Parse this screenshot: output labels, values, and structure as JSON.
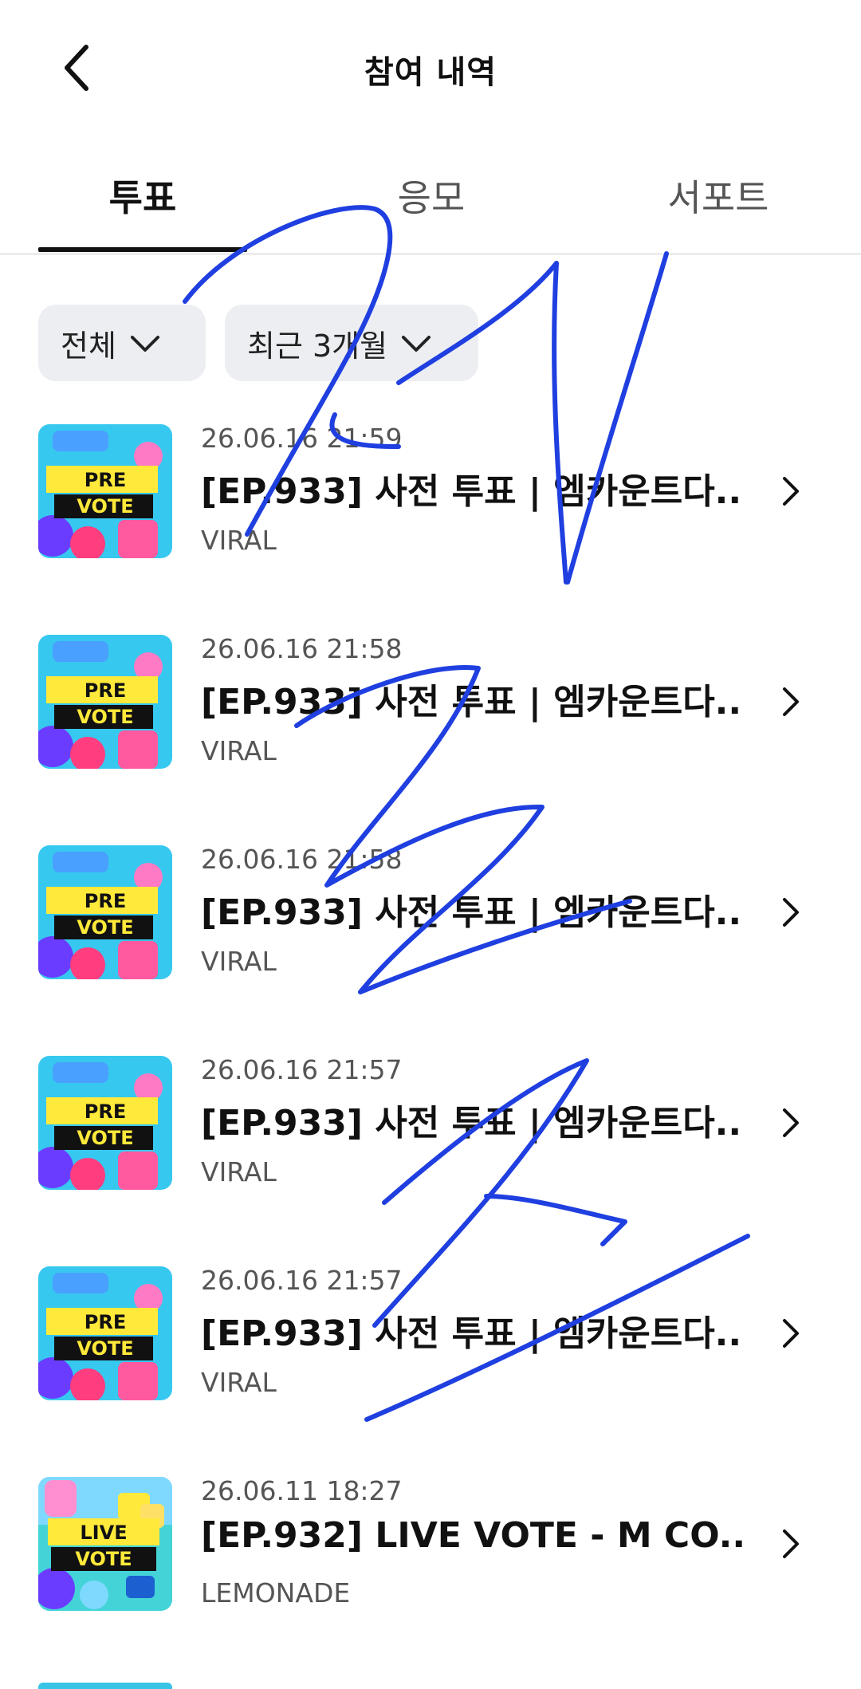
{
  "header": {
    "title": "참여 내역",
    "back_icon": "chevron-left-icon"
  },
  "tabs": [
    {
      "label": "투표",
      "active": true
    },
    {
      "label": "응모",
      "active": false
    },
    {
      "label": "서포트",
      "active": false
    }
  ],
  "filters": [
    {
      "label": "전체",
      "icon": "chevron-down-icon"
    },
    {
      "label": "최근 3개월",
      "icon": "chevron-down-icon"
    }
  ],
  "items": [
    {
      "date": "26.06.16 21:59",
      "title": "[EP.933] 사전 투표 | 엠카운트다...",
      "brand": "VIRAL",
      "badge_top": "PRE",
      "badge_bottom": "VOTE"
    },
    {
      "date": "26.06.16 21:58",
      "title": "[EP.933] 사전 투표 | 엠카운트다...",
      "brand": "VIRAL",
      "badge_top": "PRE",
      "badge_bottom": "VOTE"
    },
    {
      "date": "26.06.16 21:58",
      "title": "[EP.933] 사전 투표 | 엠카운트다...",
      "brand": "VIRAL",
      "badge_top": "PRE",
      "badge_bottom": "VOTE"
    },
    {
      "date": "26.06.16 21:57",
      "title": "[EP.933] 사전 투표 | 엠카운트다...",
      "brand": "VIRAL",
      "badge_top": "PRE",
      "badge_bottom": "VOTE"
    },
    {
      "date": "26.06.16 21:57",
      "title": "[EP.933] 사전 투표 | 엠카운트다...",
      "brand": "VIRAL",
      "badge_top": "PRE",
      "badge_bottom": "VOTE"
    },
    {
      "date": "26.06.11 18:27",
      "title": "[EP.932] LIVE VOTE - M CO...",
      "brand": "LEMONADE",
      "badge_top": "LIVE",
      "badge_bottom": "VOTE"
    }
  ],
  "colors": {
    "scribble": "#1f3fe0",
    "chip_bg": "#eceef2",
    "thumb_pre_bg": "#37c8ef",
    "thumb_live_bg": "#44d4d8"
  }
}
